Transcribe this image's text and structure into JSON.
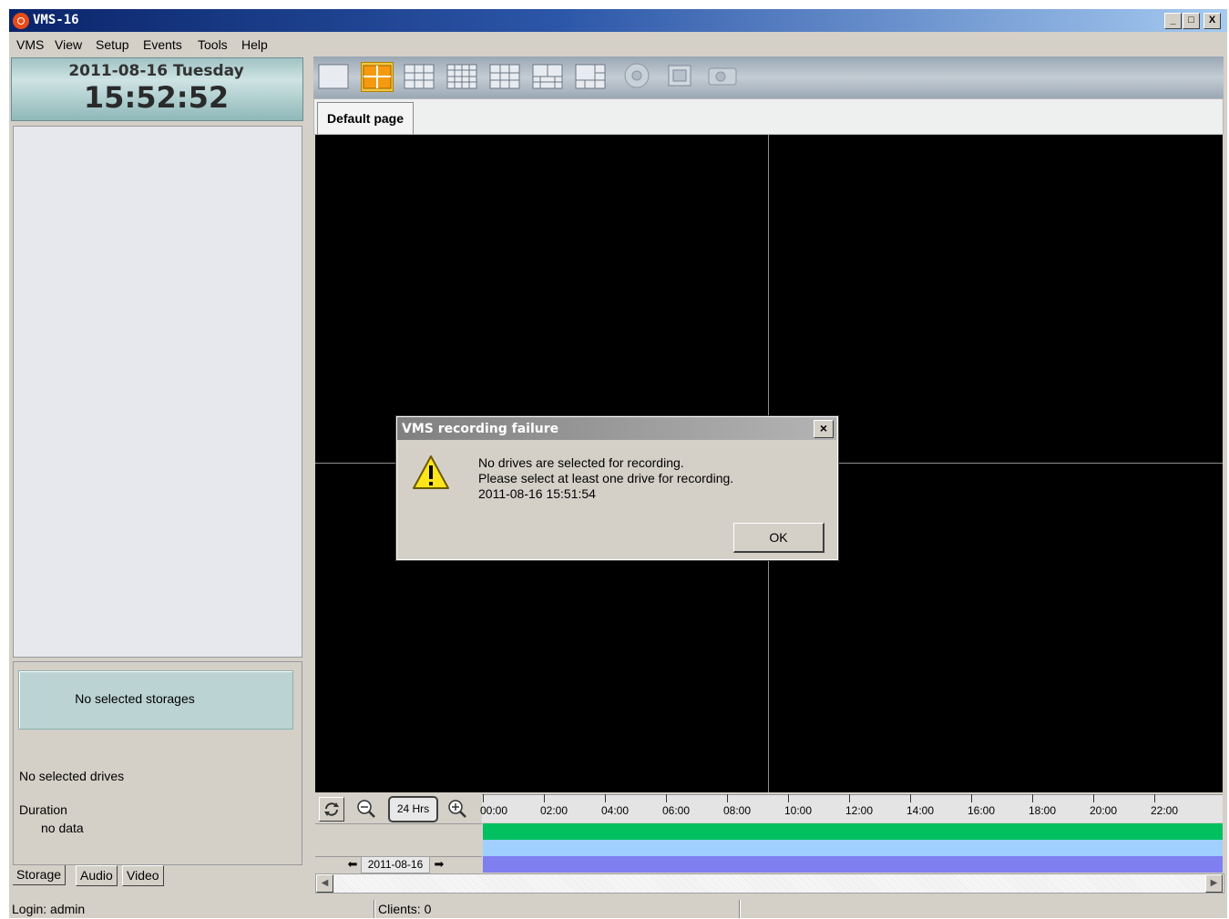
{
  "window": {
    "title": "VMS-16",
    "controls": [
      "_",
      "□",
      "X"
    ]
  },
  "menu": [
    "VMS",
    "View",
    "Setup",
    "Events",
    "Tools",
    "Help"
  ],
  "clock": {
    "date": "2011-08-16 Tuesday",
    "time": "15:52:52"
  },
  "storage": {
    "box_text": "No selected storages",
    "drives_text": "No selected drives",
    "duration_label": "Duration",
    "duration_value": "no data",
    "tabs": [
      "Storage",
      "Audio",
      "Video"
    ]
  },
  "toolbar": {
    "icons": [
      "layout-1x1-icon",
      "layout-2x2-icon",
      "layout-3x3-icon",
      "layout-4x4-icon",
      "layout-1plus5-icon",
      "layout-1plus7-icon",
      "layout-mixed-icon",
      "ptz-icon",
      "fullscreen-icon",
      "snapshot-icon"
    ],
    "selected": "layout-2x2-icon"
  },
  "page_tabs": [
    "Default page"
  ],
  "timeline": {
    "zoom_label": "24 Hrs",
    "hours": [
      "00:00",
      "02:00",
      "04:00",
      "06:00",
      "08:00",
      "10:00",
      "12:00",
      "14:00",
      "16:00",
      "18:00",
      "20:00",
      "22:00"
    ],
    "date": "2011-08-16",
    "track_colors": [
      "#00c060",
      "#9fd0ff",
      "#7f7ff0"
    ]
  },
  "status": {
    "login": "Login: admin",
    "clients": "Clients: 0"
  },
  "dialog": {
    "title": "VMS recording failure",
    "line1": "No drives are selected for recording.",
    "line2": "Please select at least one drive for recording.",
    "line3": "2011-08-16 15:51:54",
    "ok": "OK"
  }
}
